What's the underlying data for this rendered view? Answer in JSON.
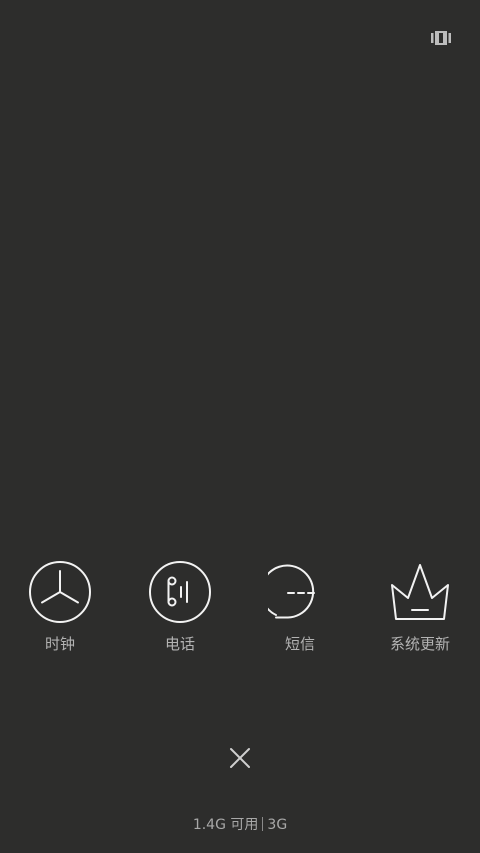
{
  "header": {
    "layout_toggle_icon": "card-stack-icon"
  },
  "apps": [
    {
      "label": "时钟",
      "icon": "clock-icon"
    },
    {
      "label": "电话",
      "icon": "phone-icon"
    },
    {
      "label": "短信",
      "icon": "message-icon"
    },
    {
      "label": "系统更新",
      "icon": "crown-icon"
    }
  ],
  "close": {
    "icon": "close-icon"
  },
  "memory": {
    "available": "1.4G 可用",
    "total": "3G"
  },
  "colors": {
    "background": "#2d2d2c",
    "icon_stroke": "#f2f2f2",
    "label": "#b3b3b3"
  }
}
